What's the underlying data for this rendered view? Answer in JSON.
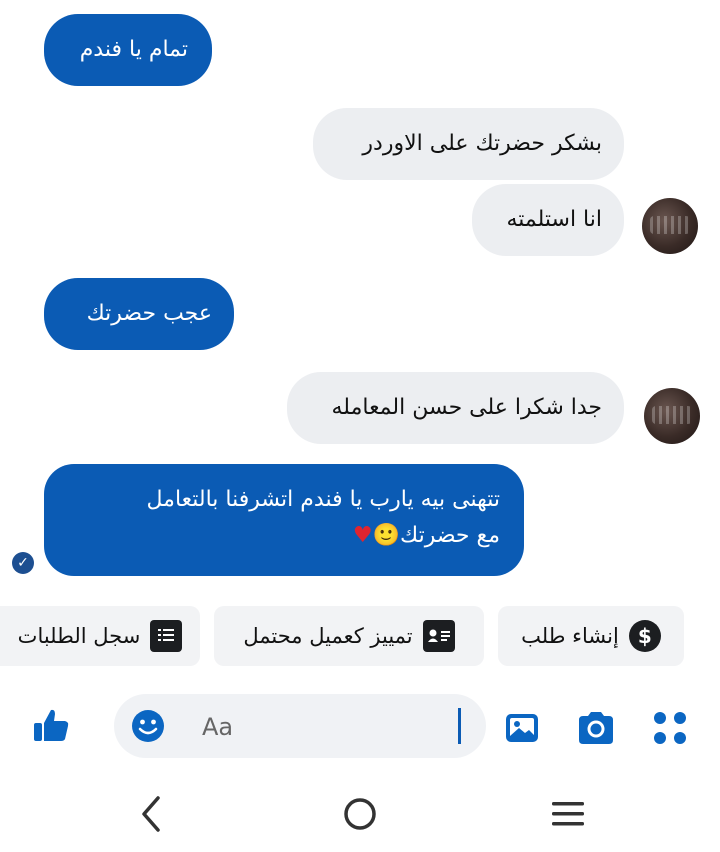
{
  "messages": [
    {
      "direction": "out",
      "text": "تمام يا فندم"
    },
    {
      "direction": "in",
      "text": "بشكر حضرتك على الاوردر"
    },
    {
      "direction": "in",
      "text": "انا استلمته"
    },
    {
      "direction": "out",
      "text": "عجب حضرتك"
    },
    {
      "direction": "in",
      "text": "جدا شكرا على حسن المعامله"
    },
    {
      "direction": "out",
      "line1": "تتهنى بيه يارب يا فندم اتشرفنا بالتعامل",
      "line2": "مع حضرتك",
      "emoji": "🙂♥"
    }
  ],
  "quick_actions": [
    {
      "label": "إنشاء طلب",
      "icon": "dollar-circle-icon"
    },
    {
      "label": "تمييز كعميل محتمل",
      "icon": "contact-card-icon"
    },
    {
      "label": "سجل الطلبات",
      "icon": "order-list-icon"
    }
  ],
  "composer": {
    "placeholder": "Aa"
  },
  "colors": {
    "accent": "#0b5bb4",
    "incoming_bubble": "#eceef1",
    "chip_bg": "#f2f3f5"
  }
}
